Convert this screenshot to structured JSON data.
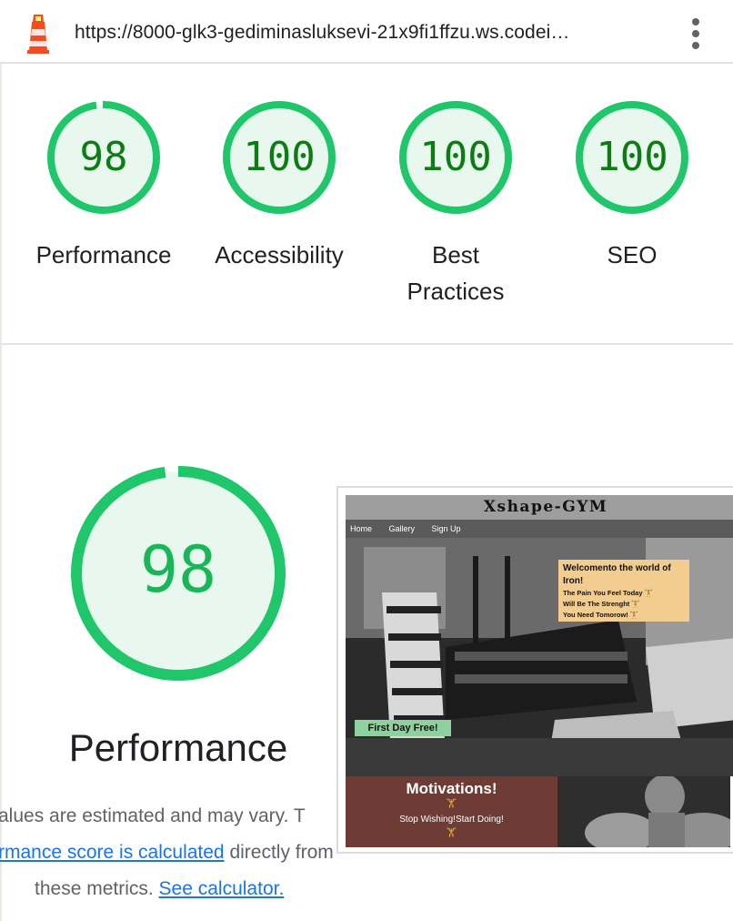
{
  "topbar": {
    "url": "https://8000-glk3-gediminasluksevi-21x9fi1ffzu.ws.codei…",
    "icon": "lighthouse-icon",
    "menu_icon": "more-vert-icon"
  },
  "categories": [
    {
      "score": "98",
      "label": "Performance",
      "fraction": 0.98
    },
    {
      "score": "100",
      "label": "Accessibility",
      "fraction": 1.0
    },
    {
      "score": "100",
      "label_line1": "Best",
      "label_line2": "Practices",
      "fraction": 1.0
    },
    {
      "score": "100",
      "label": "SEO",
      "fraction": 1.0
    }
  ],
  "performance": {
    "score": "98",
    "fraction": 0.98,
    "title": "Performance",
    "desc_line1": "alues are estimated and may vary. T",
    "desc_link1": "rmance score is calculated",
    "desc_line2_rest": " directly from",
    "desc_line3": "these metrics. ",
    "desc_link2": "See calculator."
  },
  "screenshot": {
    "site_title": "Xshape-GYM",
    "nav": [
      "Home",
      "Gallery",
      "Sign Up"
    ],
    "hero_heading": "Welcomento the world of Iron!",
    "hero_lines": [
      "The Pain You Feel Today 🏋",
      "Will Be The Strenght 🏋",
      "You Need Tomorow! 🏋"
    ],
    "free_tag": "First Day Free!",
    "motivation_title": "Motivations!",
    "motivation_icon": "🏋",
    "motivation_text": "Stop Wishing!Start Doing!"
  },
  "colors": {
    "pass_green": "#0b7d12",
    "gauge_ring": "#1fc66a",
    "gauge_fill": "#e8f8ee",
    "link": "#1a73e8",
    "motivation_bg": "#6e3b35",
    "hero_box": "#f3cd8f",
    "free_tag": "#8fd19e"
  }
}
